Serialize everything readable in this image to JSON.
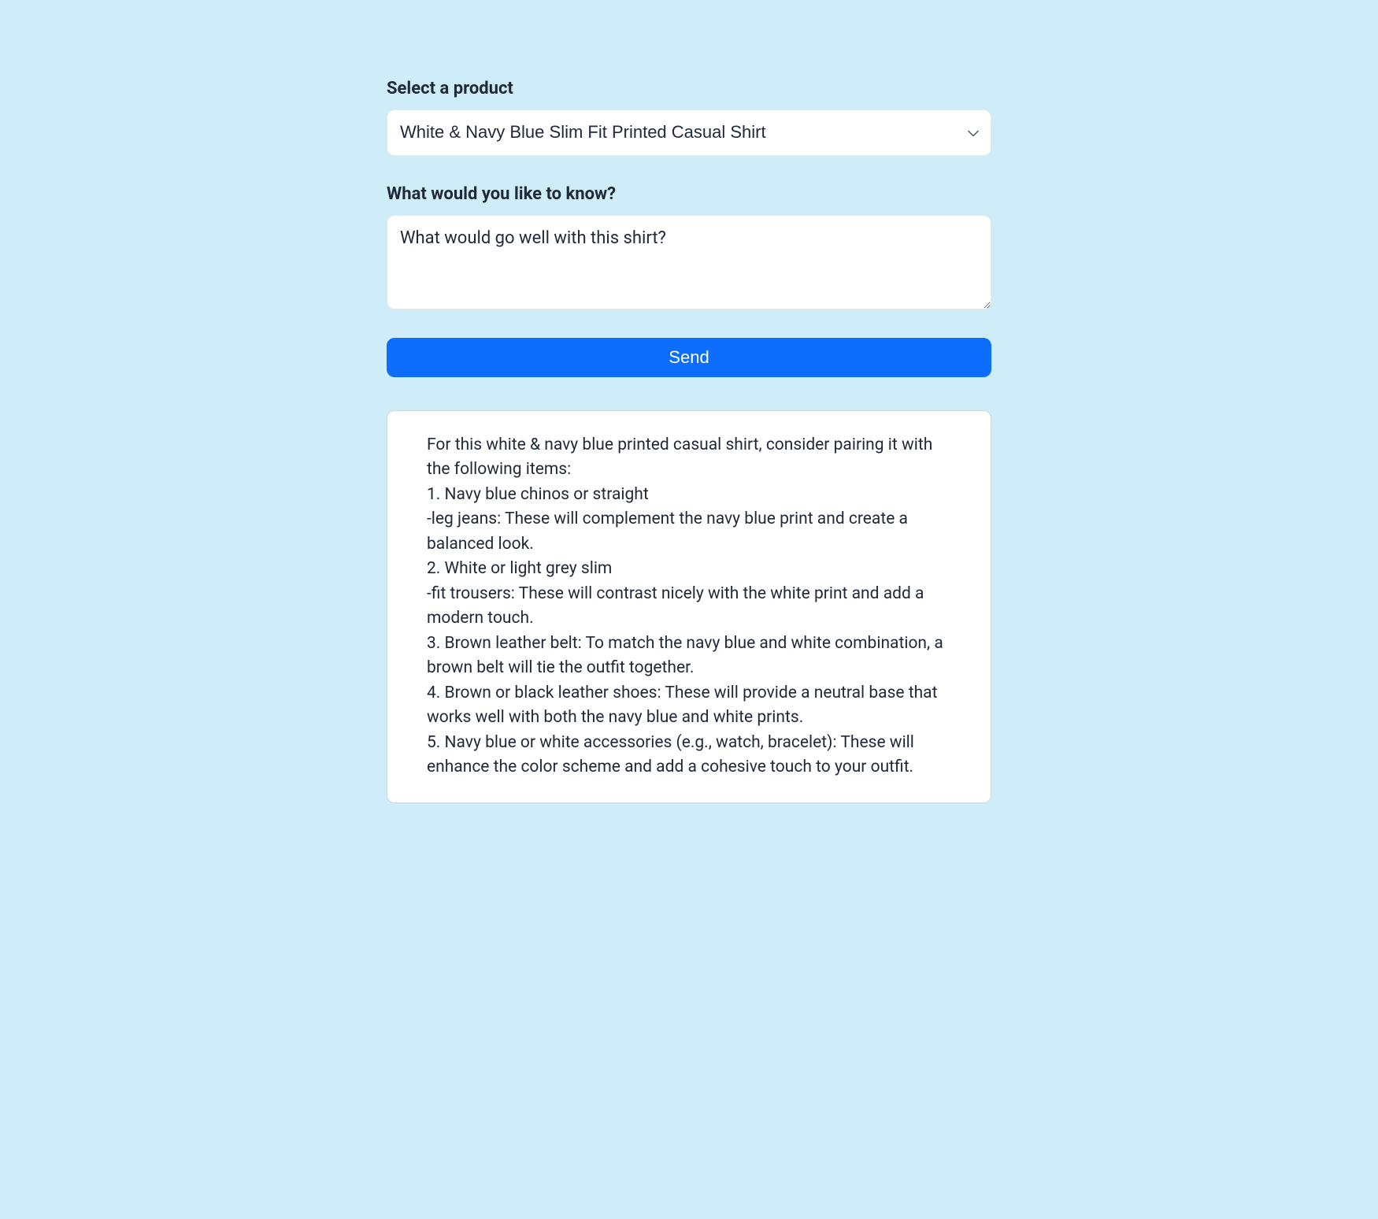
{
  "form": {
    "product_label": "Select a product",
    "product_selected": "White & Navy Blue Slim Fit Printed Casual Shirt",
    "question_label": "What would you like to know?",
    "question_value": "What would go well with this shirt?",
    "send_label": "Send"
  },
  "response": {
    "text": "For this white & navy blue printed casual shirt, consider pairing it with the following items:\n1. Navy blue chinos or straight\n-leg jeans: These will complement the navy blue print and create a balanced look.\n2. White or light grey slim\n-fit trousers: These will contrast nicely with the white print and add a modern touch.\n3. Brown leather belt: To match the navy blue and white combination, a brown belt will tie the outfit together.\n4. Brown or black leather shoes: These will provide a neutral base that works well with both the navy blue and white prints.\n5. Navy blue or white accessories (e.g., watch, bracelet): These will enhance the color scheme and add a cohesive touch to your outfit."
  }
}
